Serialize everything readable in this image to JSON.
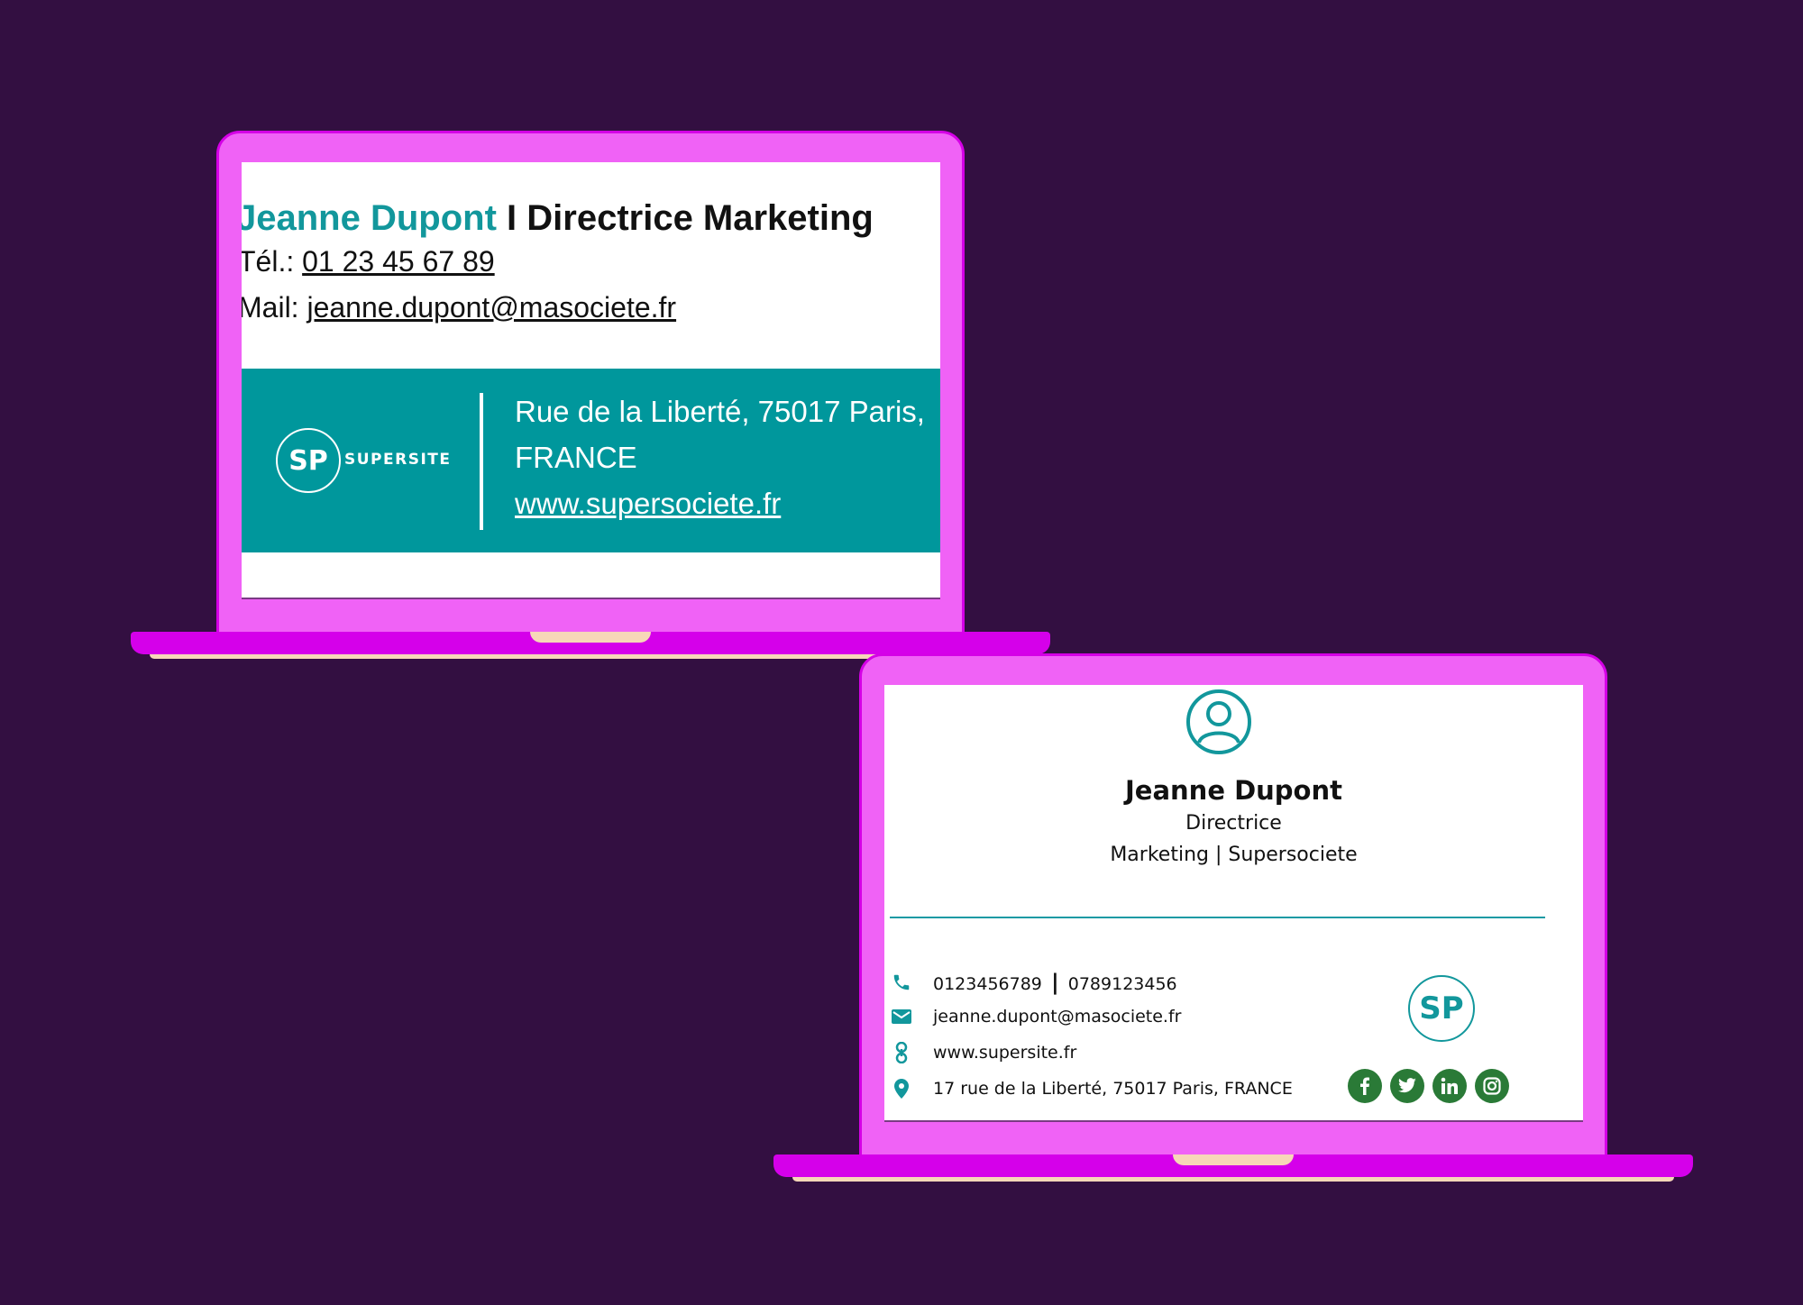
{
  "colors": {
    "background": "#330f41",
    "laptop_lid": "#f062f6",
    "laptop_base": "#d500ea",
    "teal": "#00979c",
    "social_green": "#2a7a37"
  },
  "signature1": {
    "name": "Jeanne Dupont",
    "separator_title": "I Directrice Marketing",
    "phone_label": "Tél.: ",
    "phone": "01 23 45 67 89",
    "mail_label": "Mail: ",
    "email": "jeanne.dupont@masociete.fr",
    "logo_initials": "SP",
    "logo_brand": "SUPERSITE",
    "address_line1": "Rue de la Liberté, 75017 Paris,",
    "address_line2": "FRANCE",
    "website": "www.supersociete.fr"
  },
  "signature2": {
    "avatar_icon": "user-circle-icon",
    "name": "Jeanne Dupont",
    "title_line1": "Directrice",
    "title_line2": "Marketing | Supersociete",
    "phone1": "0123456789",
    "phone_separator": "|",
    "phone2": "0789123456",
    "email": "jeanne.dupont@masociete.fr",
    "website": "www.supersite.fr",
    "address": "17 rue de la Liberté, 75017 Paris, FRANCE",
    "logo_initials": "SP",
    "social": [
      "facebook-icon",
      "twitter-icon",
      "linkedin-icon",
      "instagram-icon"
    ]
  }
}
